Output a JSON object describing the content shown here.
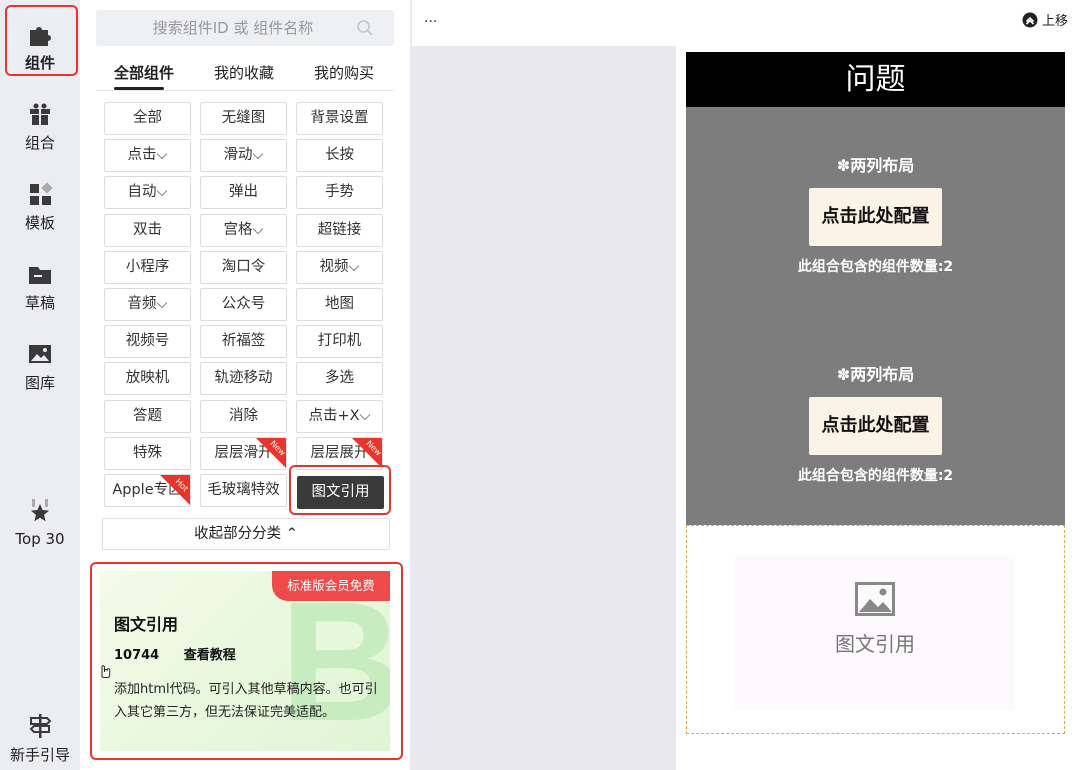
{
  "rail": {
    "items": [
      {
        "label": "组件",
        "icon": "puzzle-icon"
      },
      {
        "label": "组合",
        "icon": "gift-icon"
      },
      {
        "label": "模板",
        "icon": "template-icon"
      },
      {
        "label": "草稿",
        "icon": "folder-icon"
      },
      {
        "label": "图库",
        "icon": "image-icon"
      },
      {
        "label": "Top 30",
        "icon": "star-icon"
      },
      {
        "label": "新手引导",
        "icon": "signpost-icon"
      }
    ]
  },
  "search": {
    "placeholder": "搜索组件ID 或 组件名称"
  },
  "tabs": [
    "全部组件",
    "我的收藏",
    "我的购买"
  ],
  "grid": [
    [
      "全部",
      "无缝图",
      "背景设置"
    ],
    [
      "点击⌵",
      "滑动⌵",
      "长按"
    ],
    [
      "自动⌵",
      "弹出",
      "手势"
    ],
    [
      "双击",
      "宫格⌵",
      "超链接"
    ],
    [
      "小程序",
      "淘口令",
      "视频⌵"
    ],
    [
      "音频⌵",
      "公众号",
      "地图"
    ],
    [
      "视频号",
      "祈福签",
      "打印机"
    ],
    [
      "放映机",
      "轨迹移动",
      "多选"
    ],
    [
      "答题",
      "消除",
      "点击+X⌵"
    ],
    [
      "特殊",
      "层层滑开",
      "层层展开"
    ],
    [
      "Apple专区",
      "毛玻璃特效",
      "图文引用"
    ]
  ],
  "badges": {
    "new": "New",
    "hot": "Hot"
  },
  "collapse_label": "收起部分分类 ⌃",
  "card": {
    "ribbon": "标准版会员免费",
    "title": "图文引用",
    "id": "10744",
    "tutorial": "查看教程",
    "description": "添加html代码。可引入其他草稿内容。也可引入其它第三方，但无法保证完美适配。",
    "watermark": "B"
  },
  "topbar": {
    "dots": "...",
    "up_label": "上移"
  },
  "preview": {
    "title": "问题",
    "blocks": [
      {
        "label": "✽两列布局",
        "button": "点击此处配置",
        "count": "此组合包含的组件数量:2"
      },
      {
        "label": "✽两列布局",
        "button": "点击此处配置",
        "count": "此组合包含的组件数量:2"
      }
    ],
    "placeholder_text": "图文引用"
  },
  "colors": {
    "highlight": "#e8352c",
    "ribbon": "#ef4a4a",
    "selected": "#3a3a3a",
    "config_button": "#fbf4e6"
  }
}
